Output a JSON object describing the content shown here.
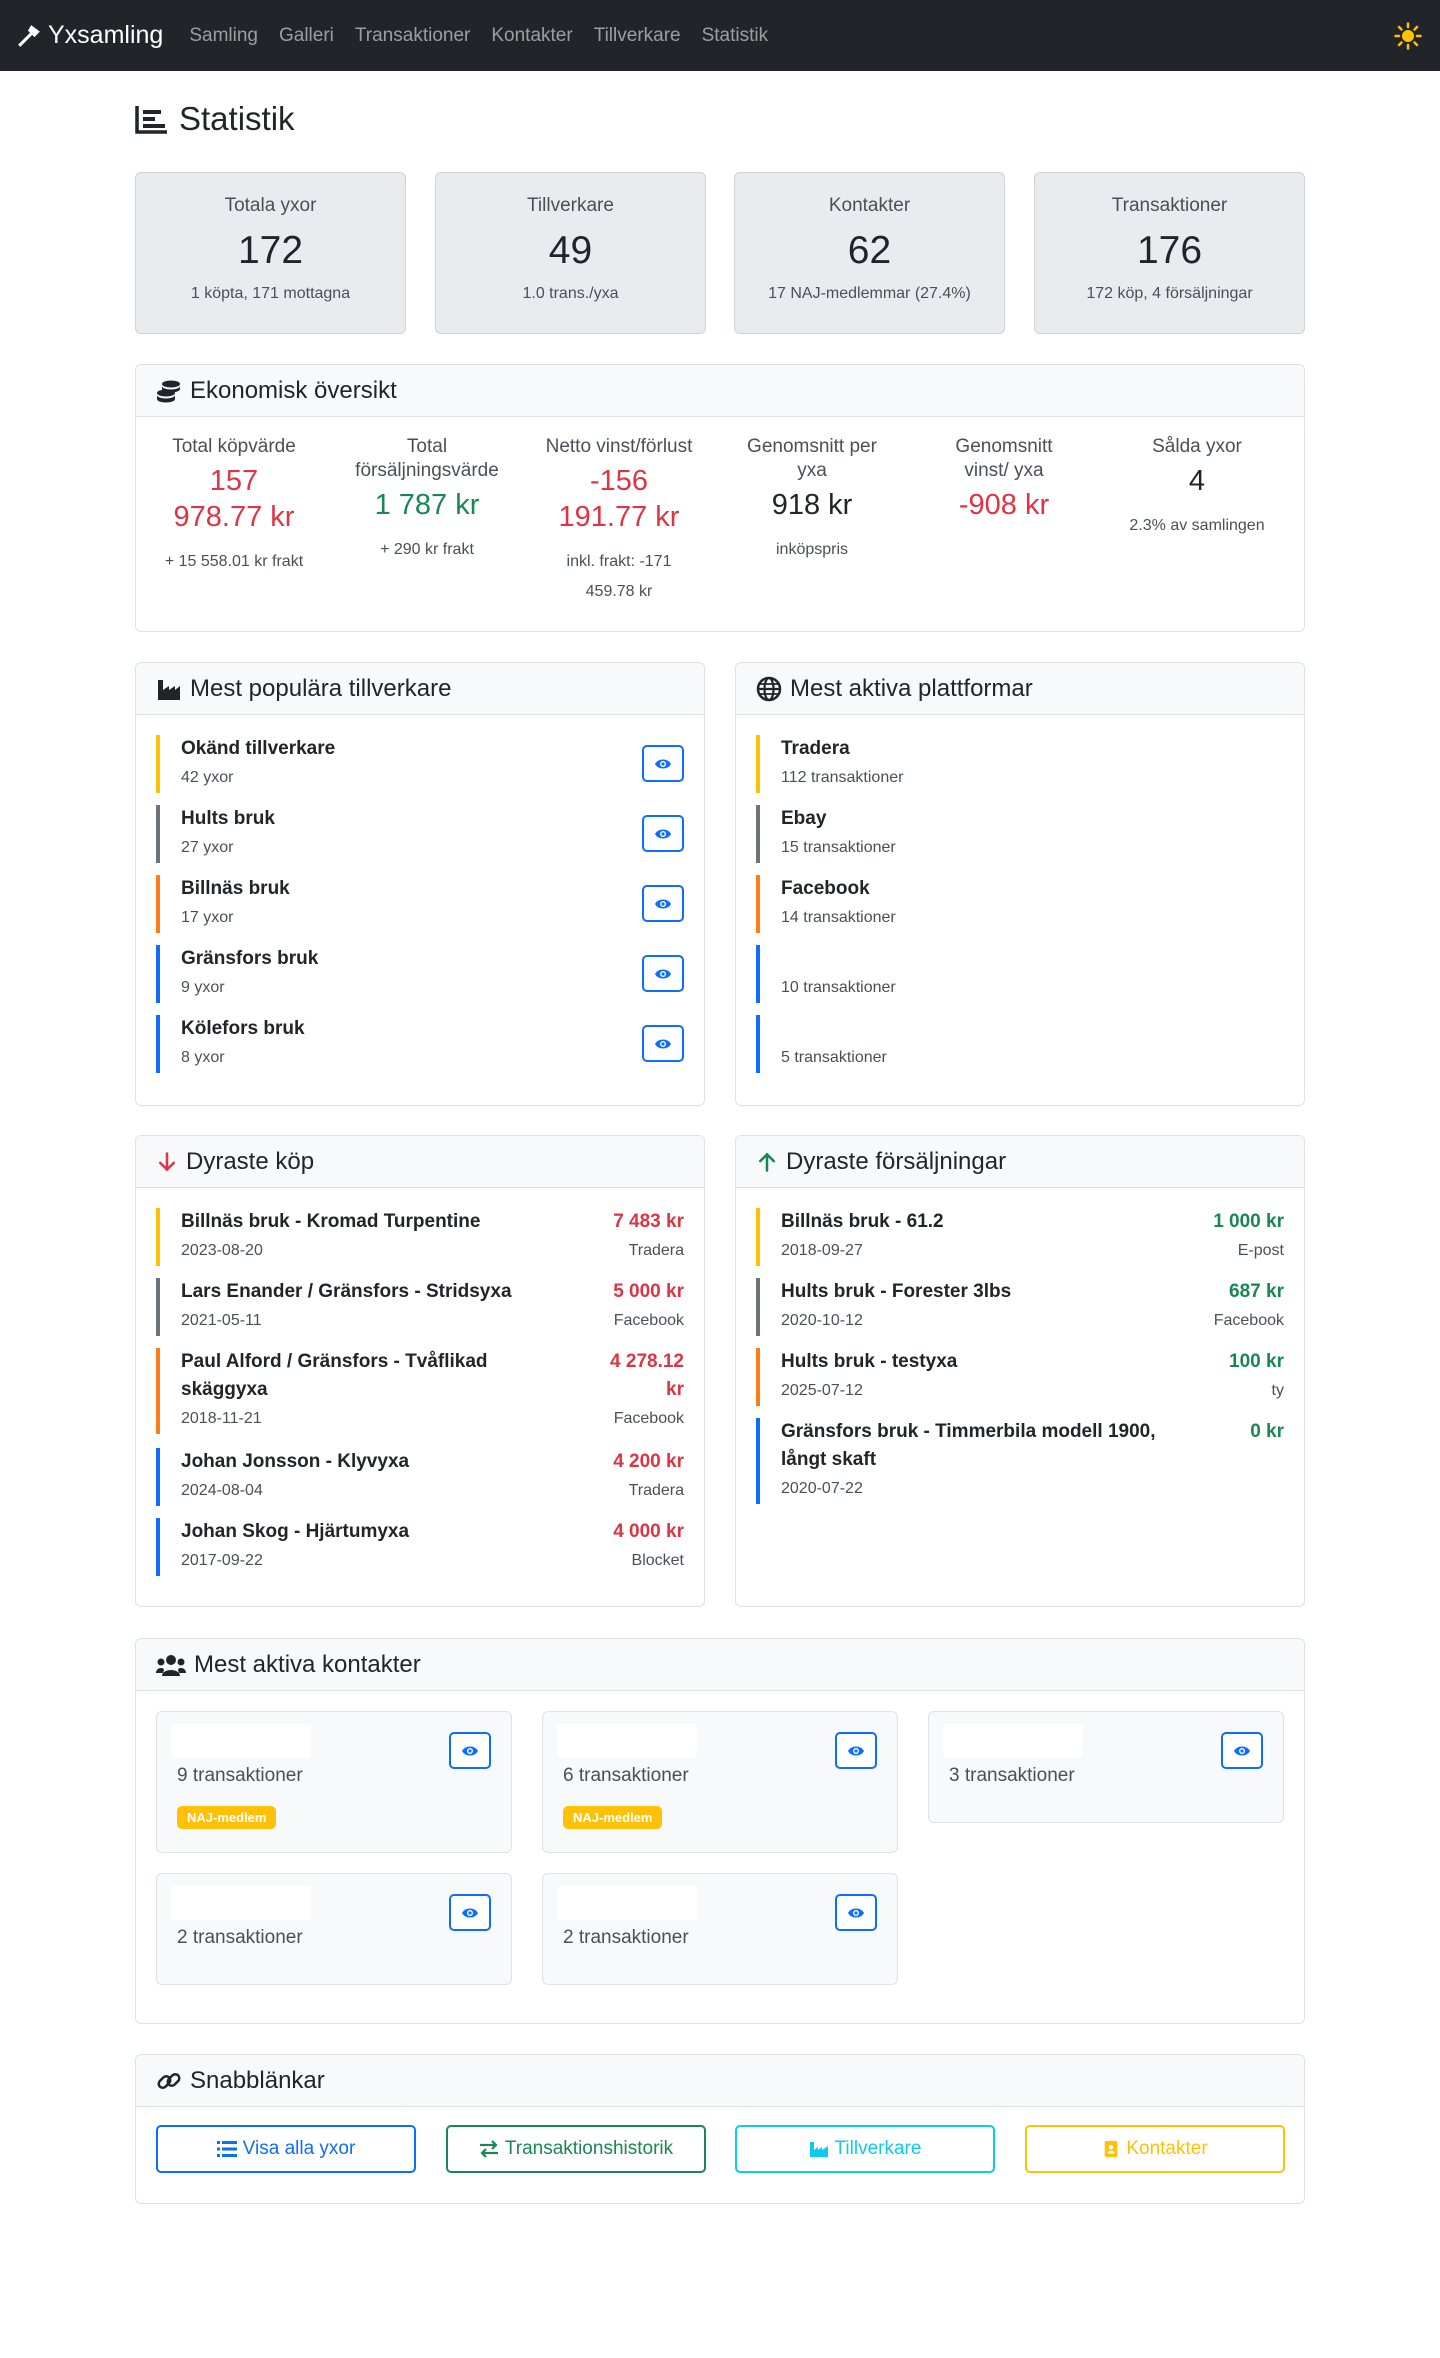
{
  "nav": {
    "brand": "Yxsamling",
    "links": [
      "Samling",
      "Galleri",
      "Transaktioner",
      "Kontakter",
      "Tillverkare",
      "Statistik"
    ]
  },
  "page_title": "Statistik",
  "stats": [
    {
      "label": "Totala yxor",
      "value": "172",
      "sub": "1 köpta, 171 mottagna"
    },
    {
      "label": "Tillverkare",
      "value": "49",
      "sub": "1.0 trans./yxa"
    },
    {
      "label": "Kontakter",
      "value": "62",
      "sub": "17 NAJ-medlemmar (27.4%)"
    },
    {
      "label": "Transaktioner",
      "value": "176",
      "sub": "172 köp, 4 försäljningar"
    }
  ],
  "economy": {
    "title": "Ekonomisk översikt",
    "cols": [
      {
        "label": "Total köpvärde",
        "value": "157 978.77 kr",
        "sub": "+ 15 558.01 kr frakt",
        "color": "#dc3545"
      },
      {
        "label": "Total försäljningsvärde",
        "value": "1 787 kr",
        "sub": "+ 290 kr frakt",
        "color": "#198754"
      },
      {
        "label": "Netto vinst/förlust",
        "value": "-156 191.77 kr",
        "sub": "inkl. frakt: -171 459.78 kr",
        "color": "#dc3545"
      },
      {
        "label": "Genomsnitt per yxa",
        "value": "918 kr",
        "sub": "inköpspris",
        "color": "#212529"
      },
      {
        "label": "Genomsnitt vinst/ yxa",
        "value": "-908 kr",
        "sub": "",
        "color": "#dc3545"
      },
      {
        "label": "Sålda yxor",
        "value": "4",
        "sub": "2.3% av samlingen",
        "color": "#212529"
      }
    ]
  },
  "manufacturers": {
    "title": "Mest populära tillverkare",
    "items": [
      {
        "name": "Okänd tillverkare",
        "count": "42 yxor",
        "color": "#ffc107"
      },
      {
        "name": "Hults bruk",
        "count": "27 yxor",
        "color": "#6c757d"
      },
      {
        "name": "Billnäs bruk",
        "count": "17 yxor",
        "color": "#fd7e14"
      },
      {
        "name": "Gränsfors bruk",
        "count": "9 yxor",
        "color": "#0d6efd"
      },
      {
        "name": "Kölefors bruk",
        "count": "8 yxor",
        "color": "#0d6efd"
      }
    ]
  },
  "platforms": {
    "title": "Mest aktiva plattformar",
    "items": [
      {
        "name": "Tradera",
        "count": "112 transaktioner",
        "color": "#ffc107"
      },
      {
        "name": "Ebay",
        "count": "15 transaktioner",
        "color": "#6c757d"
      },
      {
        "name": "Facebook",
        "count": "14 transaktioner",
        "color": "#fd7e14"
      },
      {
        "name": "",
        "count": "10 transaktioner",
        "color": "#0d6efd"
      },
      {
        "name": "",
        "count": "5 transaktioner",
        "color": "#0d6efd"
      }
    ]
  },
  "expensive_buys": {
    "title": "Dyraste köp",
    "items": [
      {
        "name": "Billnäs bruk - Kromad Turpentine",
        "date": "2023-08-20",
        "amount": "7 483 kr",
        "platform": "Tradera",
        "color": "#ffc107"
      },
      {
        "name": "Lars Enander / Gränsfors - Stridsyxa",
        "date": "2021-05-11",
        "amount": "5 000 kr",
        "platform": "Facebook",
        "color": "#6c757d"
      },
      {
        "name": "Paul Alford / Gränsfors - Tvåflikad skäggyxa",
        "date": "2018-11-21",
        "amount": "4 278.12 kr",
        "platform": "Facebook",
        "color": "#fd7e14"
      },
      {
        "name": "Johan Jonsson - Klyvyxa",
        "date": "2024-08-04",
        "amount": "4 200 kr",
        "platform": "Tradera",
        "color": "#0d6efd"
      },
      {
        "name": "Johan Skog - Hjärtumyxa",
        "date": "2017-09-22",
        "amount": "4 000 kr",
        "platform": "Blocket",
        "color": "#0d6efd"
      }
    ]
  },
  "expensive_sales": {
    "title": "Dyraste försäljningar",
    "items": [
      {
        "name": "Billnäs bruk - 61.2",
        "date": "2018-09-27",
        "amount": "1 000 kr",
        "platform": "E-post",
        "color": "#ffc107"
      },
      {
        "name": "Hults bruk - Forester 3lbs",
        "date": "2020-10-12",
        "amount": "687 kr",
        "platform": "Facebook",
        "color": "#6c757d"
      },
      {
        "name": "Hults bruk - testyxa",
        "date": "2025-07-12",
        "amount": "100 kr",
        "platform": "ty",
        "color": "#fd7e14"
      },
      {
        "name": "Gränsfors bruk - Timmerbila modell 1900, långt skaft",
        "date": "2020-07-22",
        "amount": "0 kr",
        "platform": "",
        "color": "#0d6efd"
      }
    ]
  },
  "contacts": {
    "title": "Mest aktiva kontakter",
    "items": [
      {
        "count": "9 transaktioner",
        "badge": "NAJ-medlem"
      },
      {
        "count": "6 transaktioner",
        "badge": "NAJ-medlem"
      },
      {
        "count": "3 transaktioner",
        "badge": ""
      },
      {
        "count": "2 transaktioner",
        "badge": ""
      },
      {
        "count": "2 transaktioner",
        "badge": ""
      }
    ]
  },
  "quicklinks": {
    "title": "Snabblänkar",
    "buttons": [
      {
        "label": "Visa alla yxor",
        "color": "#0d6efd",
        "icon": "list-icon"
      },
      {
        "label": "Transaktionshistorik",
        "color": "#198754",
        "icon": "exchange-icon"
      },
      {
        "label": "Tillverkare",
        "color": "#0dcaf0",
        "icon": "industry-icon"
      },
      {
        "label": "Kontakter",
        "color": "#ffc107",
        "icon": "address-book-icon"
      }
    ]
  }
}
